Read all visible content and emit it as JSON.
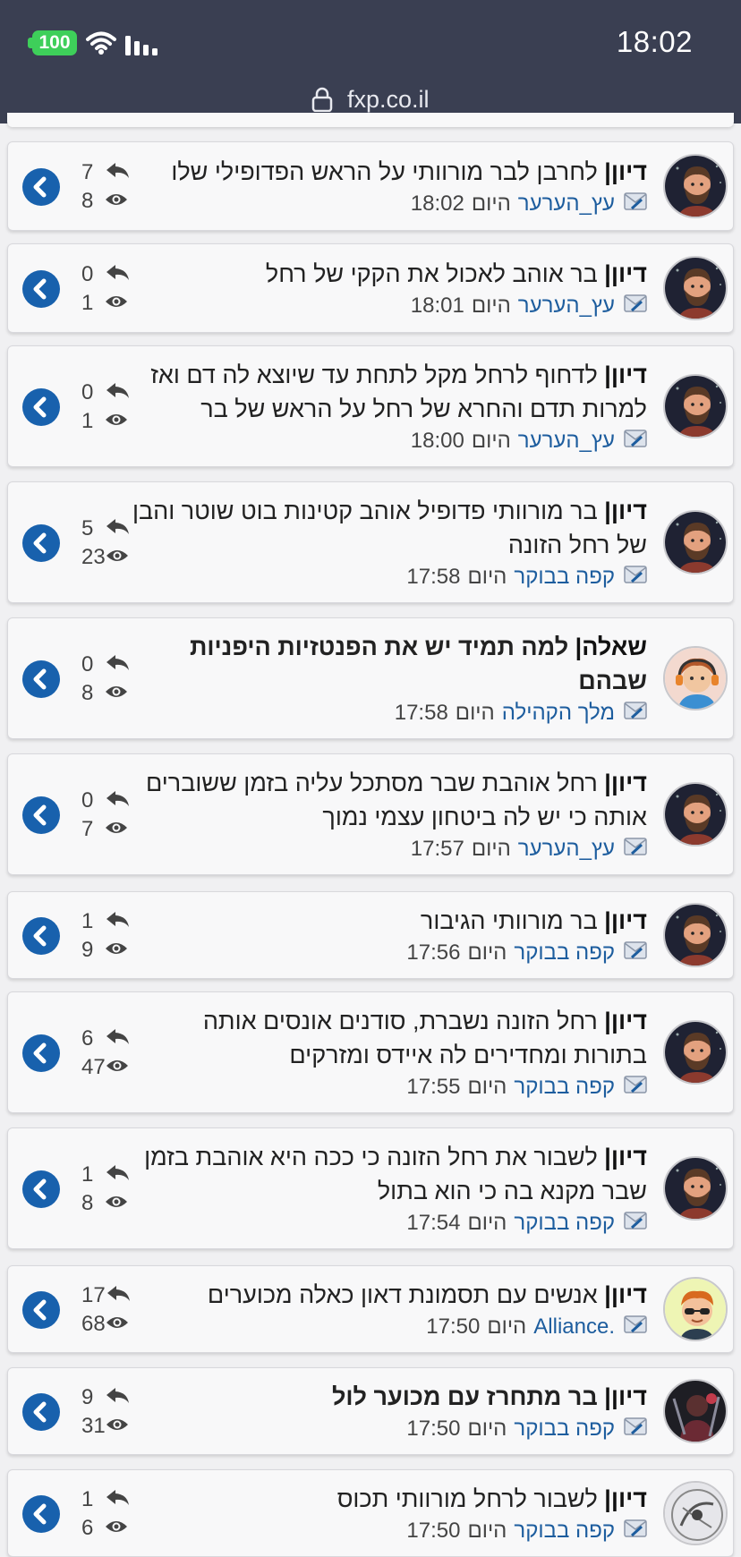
{
  "status_bar": {
    "time": "18:02",
    "battery": "100",
    "url": "fxp.co.il"
  },
  "colors": {
    "header_bg": "#3a3f52",
    "link_blue": "#1d5d9e",
    "go_button": "#1861ad",
    "battery_green": "#3ecf5a"
  },
  "threads": [
    {
      "prefix": "דיון|",
      "title": "לחרבן לבר מורוותי על הראש הפדופילי שלו",
      "author": "עץ_הערער",
      "day": "היום",
      "time": "18:02",
      "replies": "7",
      "views": "8",
      "bold": false,
      "avatar": "bearded-man-avatar"
    },
    {
      "prefix": "דיון|",
      "title": "בר אוהב לאכול את הקקי של רחל",
      "author": "עץ_הערער",
      "day": "היום",
      "time": "18:01",
      "replies": "0",
      "views": "1",
      "bold": false,
      "avatar": "bearded-man-avatar"
    },
    {
      "prefix": "דיון|",
      "title": "לדחוף לרחל מקל לתחת עד שיוצא לה דם ואז למרות תדם והחרא של רחל על הראש של בר",
      "author": "עץ_הערער",
      "day": "היום",
      "time": "18:00",
      "replies": "0",
      "views": "1",
      "bold": false,
      "avatar": "bearded-man-avatar"
    },
    {
      "prefix": "דיון|",
      "title": "בר מורוותי פדופיל אוהב קטינות בוט שוטר והבן של רחל הזונה",
      "author": "קפה בבוקר",
      "day": "היום",
      "time": "17:58",
      "replies": "5",
      "views": "23",
      "bold": false,
      "avatar": "bearded-man-avatar"
    },
    {
      "prefix": "שאלה|",
      "title": "למה תמיד יש את הפנטזיות היפניות שבהם",
      "author": "מלך הקהילה",
      "day": "היום",
      "time": "17:58",
      "replies": "0",
      "views": "8",
      "bold": true,
      "avatar": "headset-boy-avatar"
    },
    {
      "prefix": "דיון|",
      "title": "רחל אוהבת שבר מסתכל עליה בזמן ששוברים אותה כי יש לה ביטחון עצמי נמוך",
      "author": "עץ_הערער",
      "day": "היום",
      "time": "17:57",
      "replies": "0",
      "views": "7",
      "bold": false,
      "avatar": "bearded-man-avatar"
    },
    {
      "prefix": "דיון|",
      "title": "בר מורוותי הגיבור",
      "author": "קפה בבוקר",
      "day": "היום",
      "time": "17:56",
      "replies": "1",
      "views": "9",
      "bold": false,
      "avatar": "bearded-man-avatar"
    },
    {
      "prefix": "דיון|",
      "title": "רחל הזונה נשברת, סודנים אונסים אותה בתורות ומחדירים לה איידס ומזרקים",
      "author": "קפה בבוקר",
      "day": "היום",
      "time": "17:55",
      "replies": "6",
      "views": "47",
      "bold": false,
      "avatar": "bearded-man-avatar"
    },
    {
      "prefix": "דיון|",
      "title": "לשבור את רחל הזונה כי ככה היא אוהבת בזמן שבר מקנא בה כי הוא בתול",
      "author": "קפה בבוקר",
      "day": "היום",
      "time": "17:54",
      "replies": "1",
      "views": "8",
      "bold": false,
      "avatar": "bearded-man-avatar"
    },
    {
      "prefix": "דיון|",
      "title": "אנשים עם תסמונת דאון כאלה מכוערים",
      "author": ".Alliance",
      "day": "היום",
      "time": "17:50",
      "replies": "17",
      "views": "68",
      "bold": false,
      "avatar": "sunglasses-boy-avatar"
    },
    {
      "prefix": "דיון|",
      "title": "בר מתחרז עם מכוער לול",
      "author": "קפה בבוקר",
      "day": "היום",
      "time": "17:50",
      "replies": "9",
      "views": "31",
      "bold": true,
      "avatar": "dark-figure-avatar"
    },
    {
      "prefix": "דיון|",
      "title": "לשבור לרחל מורוותי תכוס",
      "author": "קפה בבוקר",
      "day": "היום",
      "time": "17:50",
      "replies": "1",
      "views": "6",
      "bold": false,
      "avatar": "sketch-avatar"
    }
  ]
}
